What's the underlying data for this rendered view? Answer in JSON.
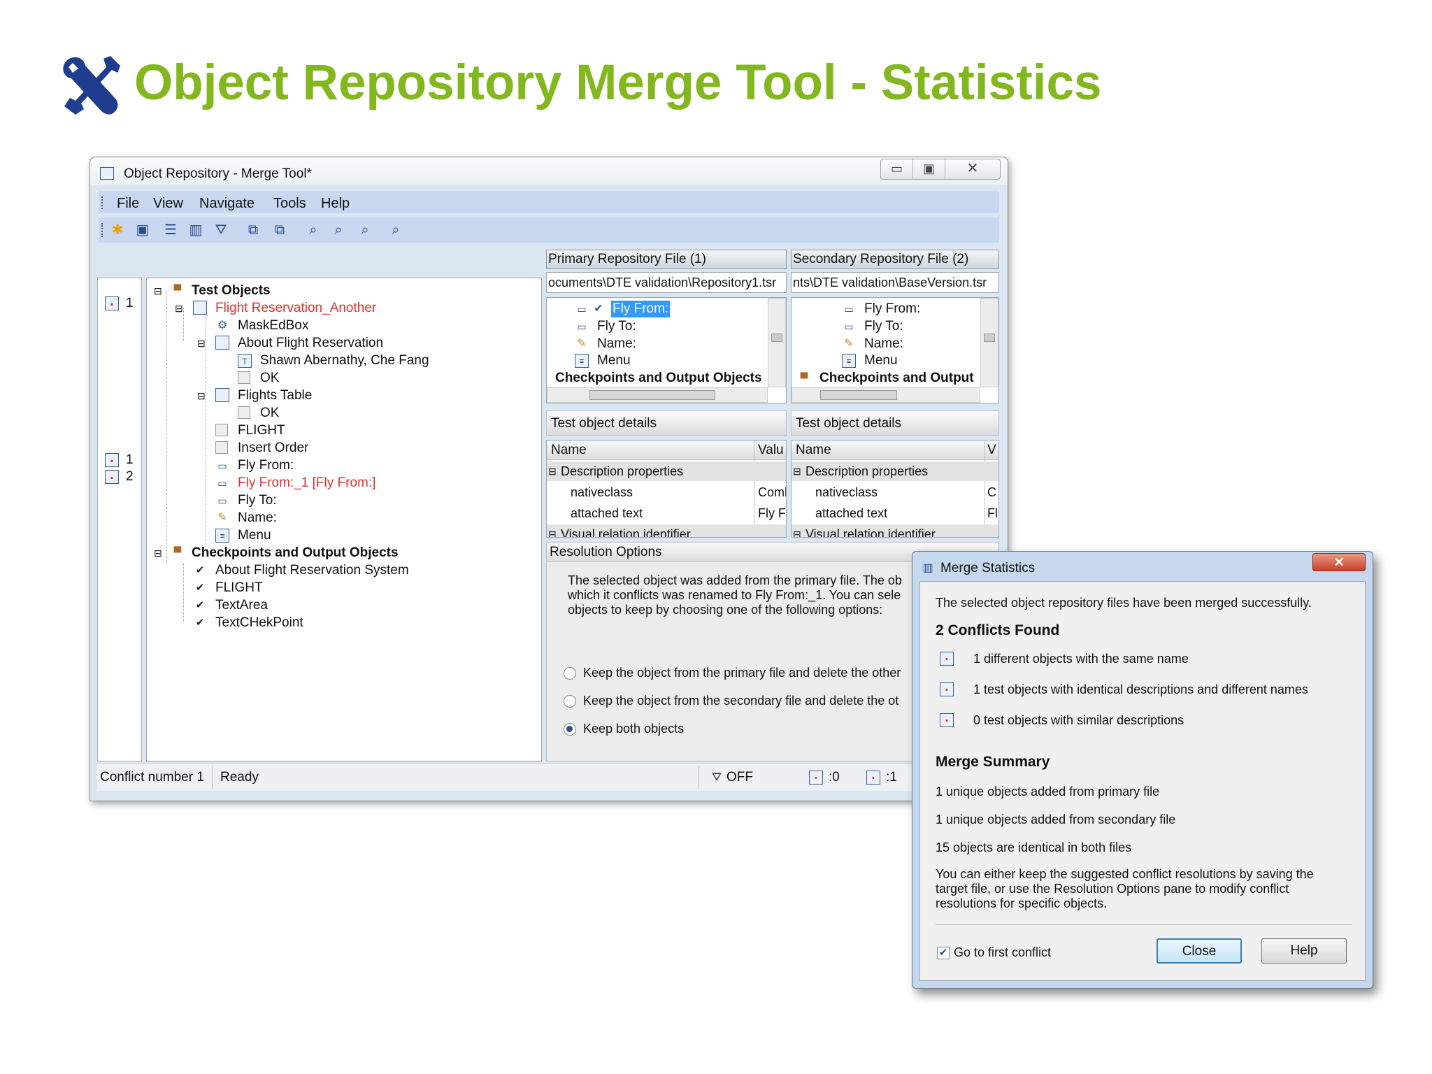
{
  "slide": {
    "title": "Object Repository Merge Tool - Statistics",
    "accent": "#82b81e",
    "icon": "tools-icon"
  },
  "window": {
    "title": "Object Repository - Merge Tool*",
    "menu": [
      "File",
      "View",
      "Navigate",
      "Tools",
      "Help"
    ],
    "toolbar_icons": [
      "new-icon",
      "save-icon",
      "properties-icon",
      "statistics-icon",
      "filter-icon",
      "previous-conflict-icon",
      "next-conflict-icon",
      "find-icon",
      "find-next-icon",
      "find-previous-icon",
      "zoom-icon"
    ],
    "tree": {
      "conflict_markers": {
        "first": "1",
        "second_a": "1",
        "second_b": "2"
      },
      "test_objects": "Test Objects",
      "items": [
        "Flight Reservation_Another",
        "MaskEdBox",
        "About Flight Reservation",
        "Shawn Abernathy, Che Fang",
        "OK",
        "Flights Table",
        "OK",
        "FLIGHT",
        "Insert Order",
        "Fly From:",
        "Fly From:_1 [Fly From:]",
        "Fly To:",
        "Name:",
        "Menu"
      ],
      "checkpoints": "Checkpoints and Output Objects",
      "cp_items": [
        "About Flight Reservation System",
        "FLIGHT",
        "TextArea",
        "TextCHekPoint"
      ]
    },
    "primary": {
      "header": "Primary Repository File (1)",
      "path": "ocuments\\DTE validation\\Repository1.tsr",
      "items": [
        "Fly From:",
        "Fly To:",
        "Name:",
        "Menu"
      ],
      "checkpoints": "Checkpoints and Output Objects",
      "details_title": "Test object details",
      "col_name": "Name",
      "col_value": "Valu",
      "section": "Description properties",
      "rows": [
        [
          "nativeclass",
          "Coml"
        ],
        [
          "attached text",
          "Fly F"
        ]
      ],
      "section2": "Visual relation identifier"
    },
    "secondary": {
      "header": "Secondary Repository File (2)",
      "path": "nts\\DTE validation\\BaseVersion.tsr",
      "items": [
        "Fly From:",
        "Fly To:",
        "Name:",
        "Menu"
      ],
      "checkpoints": "Checkpoints and Output",
      "details_title": "Test object details",
      "col_name": "Name",
      "col_value": "V",
      "section": "Description properties",
      "rows": [
        [
          "nativeclass",
          "C"
        ],
        [
          "attached text",
          "Fl"
        ]
      ],
      "section2": "Visual relation identifier"
    },
    "resolution": {
      "title": "Resolution Options",
      "text": [
        "The selected object was added from the primary file. The ob",
        "which it conflicts was renamed to Fly From:_1. You can sele",
        "objects to keep by choosing one of the following options:"
      ],
      "options": [
        "Keep the object from the primary file and delete the other",
        "Keep the object from the secondary file and delete the ot",
        "Keep both objects"
      ],
      "selected": 2
    },
    "status": {
      "conflict": "Conflict number 1",
      "state": "Ready",
      "filter": "OFF",
      "count_a": ":0",
      "count_b": ":1"
    }
  },
  "dialog": {
    "title": "Merge Statistics",
    "message": "The selected object repository files have been merged successfully.",
    "conflicts_heading": "2 Conflicts Found",
    "conflicts": [
      "1 different objects with the same name",
      "1 test objects with identical descriptions and different names",
      "0 test objects with similar descriptions"
    ],
    "summary_heading": "Merge Summary",
    "summary": [
      "1 unique objects added from primary file",
      "1 unique objects added from secondary file",
      "15 objects are identical in both files"
    ],
    "note": [
      "You can either keep the suggested conflict resolutions by saving the",
      "target file, or use the Resolution Options pane to modify conflict",
      "resolutions for specific objects."
    ],
    "checkbox_label": "Go to first conflict",
    "checkbox_checked": true,
    "close": "Close",
    "help": "Help"
  }
}
